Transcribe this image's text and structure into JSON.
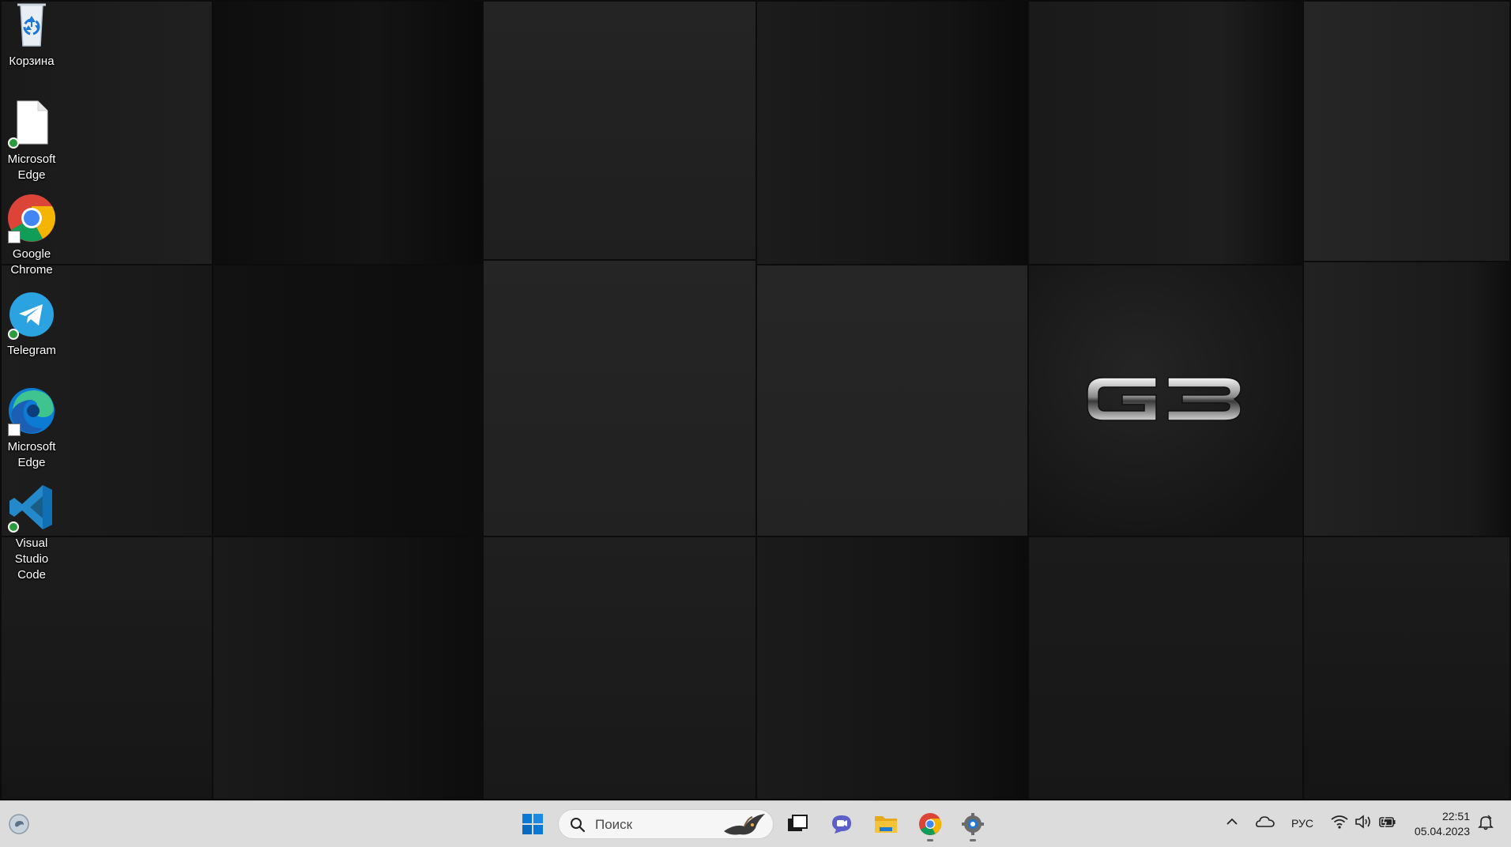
{
  "desktop": {
    "icons": [
      {
        "label": "Корзина",
        "icon": "recycle-bin-icon"
      },
      {
        "label": "Microsoft Edge",
        "icon": "blank-file-icon"
      },
      {
        "label": "Google Chrome",
        "icon": "chrome-icon"
      },
      {
        "label": "Telegram",
        "icon": "telegram-icon"
      },
      {
        "label": "Microsoft Edge",
        "icon": "edge-icon"
      },
      {
        "label": "Visual Studio Code",
        "icon": "vscode-icon"
      }
    ],
    "wallpaper_logo": "G3"
  },
  "taskbar": {
    "search_placeholder": "Поиск",
    "pinned": [
      "start-button",
      "task-view",
      "teams-chat",
      "file-explorer",
      "google-chrome",
      "settings"
    ],
    "tray": {
      "language": "РУС",
      "time": "22:51",
      "date": "05.04.2023"
    }
  },
  "colors": {
    "taskbar_bg": "#dcdcdc",
    "windows_blue": "#0a78d4",
    "teams_purple": "#5b5fc7",
    "folder_yellow": "#f5c338"
  }
}
